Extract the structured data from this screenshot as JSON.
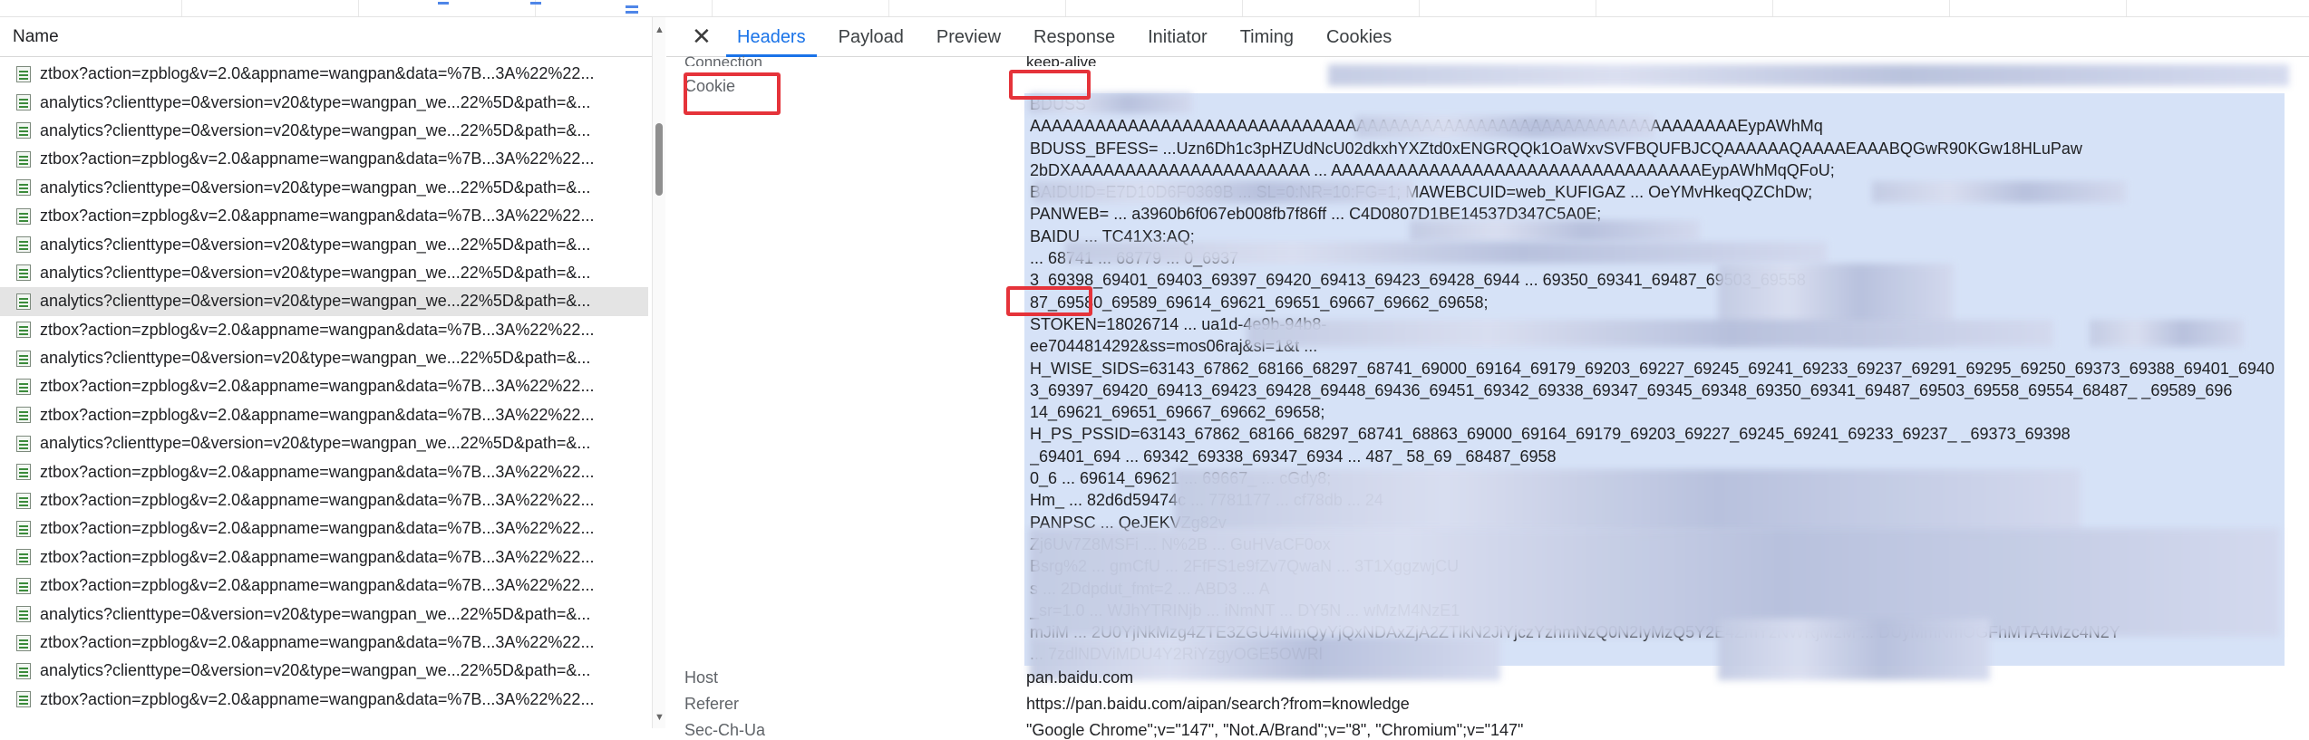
{
  "list": {
    "header": "Name",
    "rows": [
      "ztbox?action=zpblog&v=2.0&appname=wangpan&data=%7B...3A%22%22...",
      "analytics?clienttype=0&version=v20&type=wangpan_we...22%5D&path=&...",
      "analytics?clienttype=0&version=v20&type=wangpan_we...22%5D&path=&...",
      "ztbox?action=zpblog&v=2.0&appname=wangpan&data=%7B...3A%22%22...",
      "analytics?clienttype=0&version=v20&type=wangpan_we...22%5D&path=&...",
      "ztbox?action=zpblog&v=2.0&appname=wangpan&data=%7B...3A%22%22...",
      "analytics?clienttype=0&version=v20&type=wangpan_we...22%5D&path=&...",
      "analytics?clienttype=0&version=v20&type=wangpan_we...22%5D&path=&...",
      "analytics?clienttype=0&version=v20&type=wangpan_we...22%5D&path=&...",
      "ztbox?action=zpblog&v=2.0&appname=wangpan&data=%7B...3A%22%22...",
      "analytics?clienttype=0&version=v20&type=wangpan_we...22%5D&path=&...",
      "ztbox?action=zpblog&v=2.0&appname=wangpan&data=%7B...3A%22%22...",
      "ztbox?action=zpblog&v=2.0&appname=wangpan&data=%7B...3A%22%22...",
      "analytics?clienttype=0&version=v20&type=wangpan_we...22%5D&path=&...",
      "ztbox?action=zpblog&v=2.0&appname=wangpan&data=%7B...3A%22%22...",
      "ztbox?action=zpblog&v=2.0&appname=wangpan&data=%7B...3A%22%22...",
      "ztbox?action=zpblog&v=2.0&appname=wangpan&data=%7B...3A%22%22...",
      "ztbox?action=zpblog&v=2.0&appname=wangpan&data=%7B...3A%22%22...",
      "ztbox?action=zpblog&v=2.0&appname=wangpan&data=%7B...3A%22%22...",
      "analytics?clienttype=0&version=v20&type=wangpan_we...22%5D&path=&...",
      "ztbox?action=zpblog&v=2.0&appname=wangpan&data=%7B...3A%22%22...",
      "analytics?clienttype=0&version=v20&type=wangpan_we...22%5D&path=&...",
      "ztbox?action=zpblog&v=2.0&appname=wangpan&data=%7B...3A%22%22..."
    ],
    "selected_index": 8
  },
  "tabs": [
    "Headers",
    "Payload",
    "Preview",
    "Response",
    "Initiator",
    "Timing",
    "Cookies"
  ],
  "active_tab": "Headers",
  "headers": {
    "connection_name": "Connection",
    "connection_value": "keep-alive",
    "cookie_name": "Cookie",
    "cookie_lines": [
      "BDUSS",
      "AAAAAAAAAAAAAAAAAAAAAAAAAAAAAAAAAAAAAAAAAAAAAAAAAAAAAAAAAAAAAAAAAEypAWhMq",
      "BDUSS_BFESS=  ...Uzn6Dh1c3pHZUdNcU02dkxhYXZtd0xENGRQQk1OaWxvSVFBQUFBJCQAAAAAAQAAAAEAAABQGwR90KGw18HLuPaw",
      "2bDXAAAAAAAAAAAAAAAAAAAAAA ... AAAAAAAAAAAAAAAAAAAAAAAAAAAAAAAAAAEypAWhMqQFoU;",
      "BAIDUID=E7D10D6F0369B  ...  SL=0:NR=10:FG=1; MAWEBCUID=web_KUFIGAZ  ...  OeYMvHkeqQZChDw;",
      "PANWEB=  ...  a3960b6f067eb008fb7f86ff  ...  C4D0807D1BE14537D347C5A0E;",
      "BAIDU  ...  TC41X3:AQ;",
      "  ...  68741 ...  68779 ... 0_6937",
      "3_69398_69401_69403_69397_69420_69413_69423_69428_6944  ...  69350_69341_69487_69503_69558",
      "87_69580_69589_69614_69621_69651_69667_69662_69658;",
      "STOKEN=18026714  ...  ua1d-4e9b-94b8-",
      "ee7044814292&ss=mos06raj&sl=1&t  ...",
      "H_WISE_SIDS=63143_67862_68166_68297_68741_69000_69164_69179_69203_69227_69245_69241_69233_69237_69291_69295_69250_69373_69388_69401_6940",
      "3_69397_69420_69413_69423_69428_69448_69436_69451_69342_69338_69347_69345_69348_69350_69341_69487_69503_69558_69554_68487_  _69589_696",
      "14_69621_69651_69667_69662_69658;",
      "H_PS_PSSID=63143_67862_68166_68297_68741_68863_69000_69164_69179_69203_69227_69245_69241_69233_69237_  _69373_69398",
      "_69401_694  ...  69342_69338_69347_6934  ...  487_  58_69  _68487_6958",
      "0_6  ...  69614_69621  ...  69667_  ...  cGdy8;",
      "Hm_  ...  82d6d59474c  ...  7781177  ...  cf78db  ...  24",
      "PANPSC  ...  QeJEKVZg82v",
      "Zj6Uv7Z8MSFi  ...  N%2B  ...  GuHVaCF0ox",
      "Bsrg%2  ...  gmCfU  ...  2FfFS1e9fZv7QwaN  ...  3T1XggzwjCU",
      "s  ...  2Ddpdut_fmt=2  ...  ABD3  ...  A",
      "_sr=1.0  ...  WJhYTRINjb  ...  iNmNT  ...  DY5N  ...  wMzM4NzE1",
      "mJiM  ...  2U0YjNkMzg4ZTE3ZGU4MmQyYjQxNDAxZjA2ZTlkN2JiYjczYzhmNzQ0N2IyMzQ5Y2E4ZmYzNWRjM2M  ...  DUyMmNmOGFhMTA4Mzc4N2Y",
      "  ...  7zdlNDViMDU4Y2RiYzgyOGE5OWRl"
    ],
    "host_name": "Host",
    "host_value": "pan.baidu.com",
    "referer_name": "Referer",
    "referer_value": "https://pan.baidu.com/aipan/search?from=knowledge",
    "secchua_name": "Sec-Ch-Ua",
    "secchua_value": "\"Google Chrome\";v=\"147\", \"Not.A/Brand\";v=\"8\", \"Chromium\";v=\"147\""
  },
  "colors": {
    "accent": "#1a73e8",
    "highlight": "#d6e2f7",
    "annotation_red": "#e5333a",
    "selected_row": "#e4e4e4"
  },
  "icons": {
    "close": "close-icon",
    "request": "document-icon",
    "scroll_up": "scroll-up-arrow-icon",
    "scroll_down": "scroll-down-arrow-icon"
  }
}
